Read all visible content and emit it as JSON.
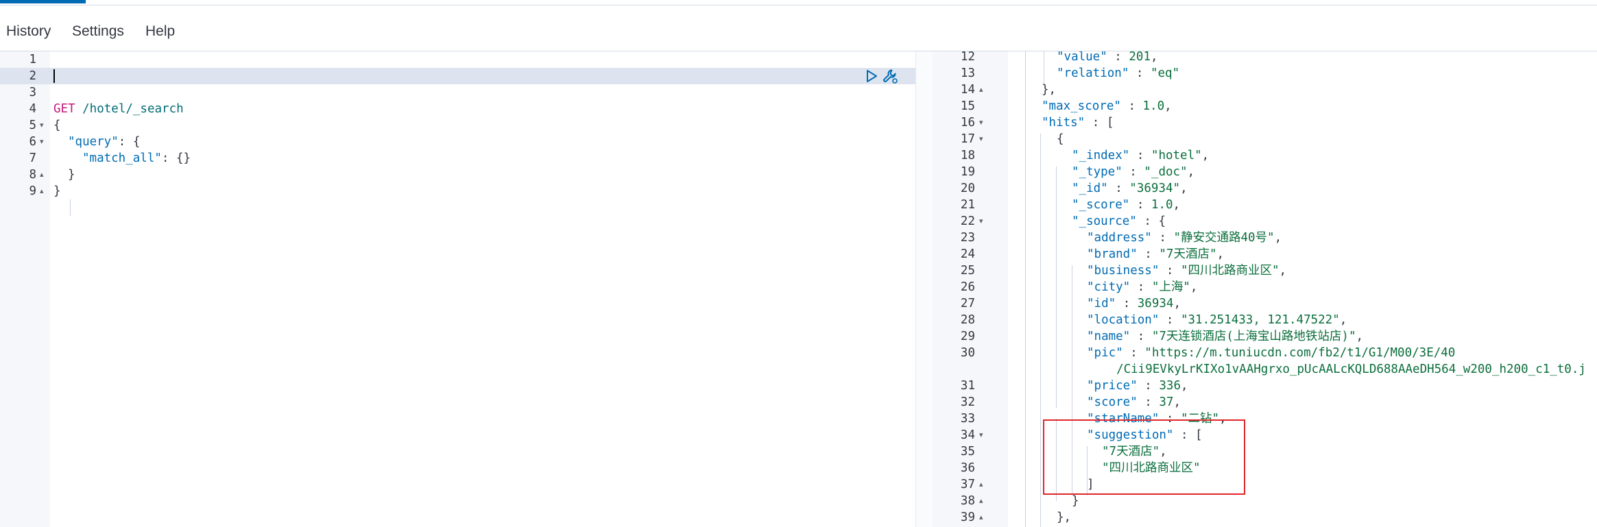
{
  "menu": {
    "history": "History",
    "settings": "Settings",
    "help": "Help"
  },
  "request_editor": {
    "lines": [
      {
        "num": "1",
        "fold": "",
        "text": ""
      },
      {
        "num": "2",
        "fold": "",
        "text": ""
      },
      {
        "num": "3",
        "fold": "",
        "text": ""
      },
      {
        "num": "4",
        "fold": "",
        "method": "GET",
        "path": " /hotel/_search"
      },
      {
        "num": "5",
        "fold": "▾",
        "text": "{"
      },
      {
        "num": "6",
        "fold": "▾",
        "key": "\"query\"",
        "rest": ": {"
      },
      {
        "num": "7",
        "fold": "",
        "key": "\"match_all\"",
        "rest": ": {}"
      },
      {
        "num": "8",
        "fold": "▴",
        "text": "}"
      },
      {
        "num": "9",
        "fold": "▴",
        "text": "}"
      }
    ]
  },
  "response_viewer": {
    "lines": [
      {
        "num": "12",
        "fold": "",
        "key": "\"value\"",
        "sep": " : ",
        "val": "201",
        "tail": ","
      },
      {
        "num": "13",
        "fold": "",
        "key": "\"relation\"",
        "sep": " : ",
        "val": "\"eq\"",
        "tail": ""
      },
      {
        "num": "14",
        "fold": "▴",
        "text": "},"
      },
      {
        "num": "15",
        "fold": "",
        "key": "\"max_score\"",
        "sep": " : ",
        "val": "1.0",
        "tail": ","
      },
      {
        "num": "16",
        "fold": "▾",
        "key": "\"hits\"",
        "sep": " : ",
        "val": "",
        "tail": "["
      },
      {
        "num": "17",
        "fold": "▾",
        "text": "{"
      },
      {
        "num": "18",
        "fold": "",
        "key": "\"_index\"",
        "sep": " : ",
        "val": "\"hotel\"",
        "tail": ","
      },
      {
        "num": "19",
        "fold": "",
        "key": "\"_type\"",
        "sep": " : ",
        "val": "\"_doc\"",
        "tail": ","
      },
      {
        "num": "20",
        "fold": "",
        "key": "\"_id\"",
        "sep": " : ",
        "val": "\"36934\"",
        "tail": ","
      },
      {
        "num": "21",
        "fold": "",
        "key": "\"_score\"",
        "sep": " : ",
        "val": "1.0",
        "tail": ","
      },
      {
        "num": "22",
        "fold": "▾",
        "key": "\"_source\"",
        "sep": " : ",
        "val": "",
        "tail": "{"
      },
      {
        "num": "23",
        "fold": "",
        "key": "\"address\"",
        "sep": " : ",
        "val": "\"静安交通路40号\"",
        "tail": ","
      },
      {
        "num": "24",
        "fold": "",
        "key": "\"brand\"",
        "sep": " : ",
        "val": "\"7天酒店\"",
        "tail": ","
      },
      {
        "num": "25",
        "fold": "",
        "key": "\"business\"",
        "sep": " : ",
        "val": "\"四川北路商业区\"",
        "tail": ","
      },
      {
        "num": "26",
        "fold": "",
        "key": "\"city\"",
        "sep": " : ",
        "val": "\"上海\"",
        "tail": ","
      },
      {
        "num": "27",
        "fold": "",
        "key": "\"id\"",
        "sep": " : ",
        "val": "36934",
        "tail": ","
      },
      {
        "num": "28",
        "fold": "",
        "key": "\"location\"",
        "sep": " : ",
        "val": "\"31.251433, 121.47522\"",
        "tail": ","
      },
      {
        "num": "29",
        "fold": "",
        "key": "\"name\"",
        "sep": " : ",
        "val": "\"7天连锁酒店(上海宝山路地铁站店)\"",
        "tail": ","
      },
      {
        "num": "30",
        "fold": "",
        "key": "\"pic\"",
        "sep": " : ",
        "val": "\"https://m.tuniucdn.com/fb2/t1/G1/M00/3E/40",
        "tail": ""
      },
      {
        "num": "",
        "fold": "",
        "key": "",
        "sep": "",
        "val": "  /Cii9EVkyLrKIXo1vAAHgrxo_pUcAALcKQLD688AAeDH564_w200_h200_c1_t0.j",
        "tail": ""
      },
      {
        "num": "31",
        "fold": "",
        "key": "\"price\"",
        "sep": " : ",
        "val": "336",
        "tail": ","
      },
      {
        "num": "32",
        "fold": "",
        "key": "\"score\"",
        "sep": " : ",
        "val": "37",
        "tail": ","
      },
      {
        "num": "33",
        "fold": "",
        "key": "\"starName\"",
        "sep": " : ",
        "val": "\"二钻\"",
        "tail": ","
      },
      {
        "num": "34",
        "fold": "▾",
        "key": "\"suggestion\"",
        "sep": " : ",
        "val": "",
        "tail": "["
      },
      {
        "num": "35",
        "fold": "",
        "key": "",
        "sep": "",
        "val": "\"7天酒店\"",
        "tail": ","
      },
      {
        "num": "36",
        "fold": "",
        "key": "",
        "sep": "",
        "val": "\"四川北路商业区\"",
        "tail": ""
      },
      {
        "num": "37",
        "fold": "▴",
        "text": "]"
      },
      {
        "num": "38",
        "fold": "▴",
        "text": "}"
      },
      {
        "num": "39",
        "fold": "▴",
        "text": "},"
      }
    ]
  },
  "icons": {
    "run": "play-triangle-icon",
    "settings": "wrench-icon"
  },
  "colors": {
    "accent": "#006bb4",
    "method": "#c3187c",
    "string": "#0b6e3c",
    "highlight": "#e0252a"
  }
}
